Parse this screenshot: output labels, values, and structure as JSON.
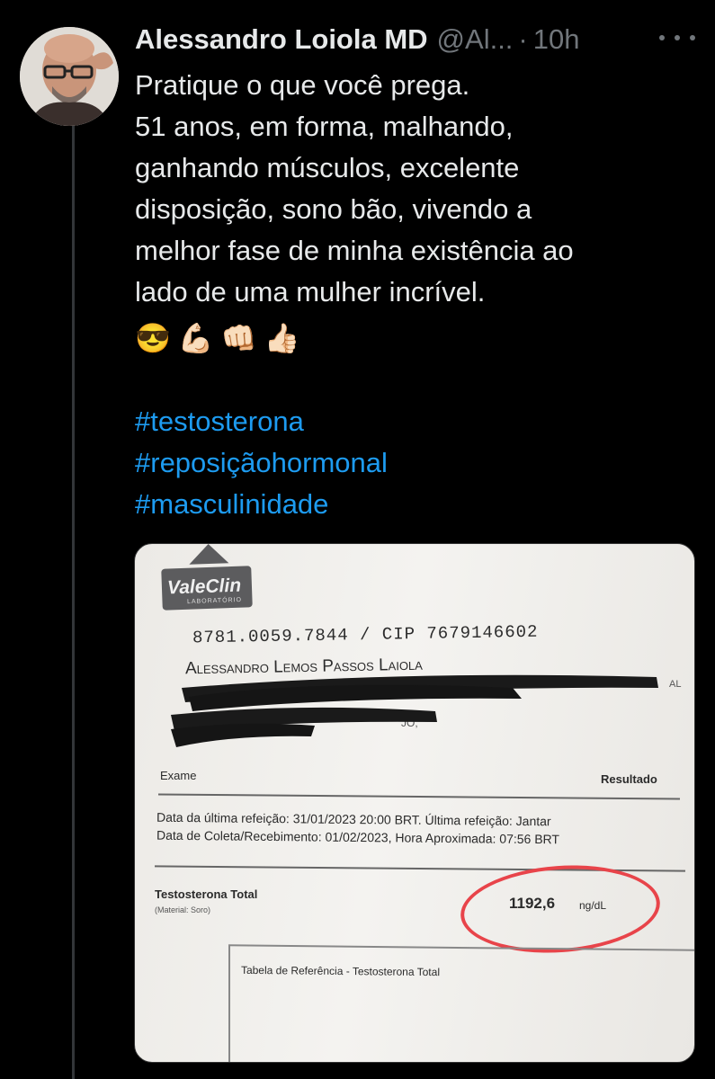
{
  "tweet": {
    "author_name": "Alessandro Loiola MD",
    "handle": "@Al...",
    "separator": "·",
    "time": "10h",
    "text_lines": [
      "Pratique o que você prega.",
      "51 anos, em forma, malhando,",
      "ganhando músculos, excelente",
      "disposição, sono bão, vivendo a",
      "melhor fase de minha existência ao",
      "lado de uma mulher incrível."
    ],
    "emojis": [
      "😎",
      "💪🏻",
      "👊🏻",
      "👍🏻"
    ],
    "hashtags": [
      "#testosterona",
      "#reposiçãohormonal",
      "#masculinidade"
    ]
  },
  "icons": {
    "avatar": "avatar-photo",
    "more": "more-options-icon"
  },
  "colors": {
    "background": "#000000",
    "text": "#e7e9ea",
    "secondary": "#71767b",
    "hashtag": "#1d9bf0",
    "circle": "#e8444a"
  },
  "document": {
    "logo": "ValeClin",
    "logo_sub": "LABORATÓRIO",
    "id_line": "8781.0059.7844 / CIP 7679146602",
    "patient": "Alessandro Lemos Passos Laiola",
    "redacted_fragment_1": "AL",
    "redacted_fragment_2": "JO,",
    "col_exam": "Exame",
    "col_result": "Resultado",
    "last_meal": "Data da última refeição: 31/01/2023 20:00 BRT. Última refeição: Jantar",
    "collection": "Data de Coleta/Recebimento: 01/02/2023, Hora Aproximada: 07:56 BRT",
    "test_name": "Testosterona Total",
    "material": "(Material: Soro)",
    "result_value": "1192,6",
    "result_unit": "ng/dL",
    "reference_table": "Tabela de Referência - Testosterona Total"
  }
}
